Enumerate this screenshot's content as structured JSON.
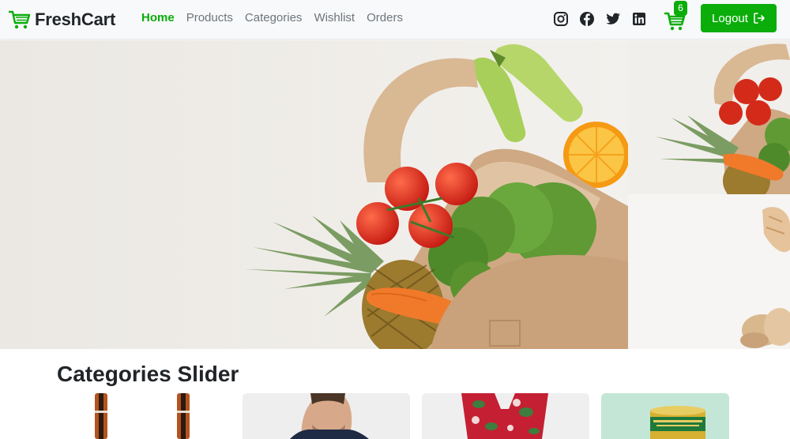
{
  "brand": {
    "name": "FreshCart",
    "icon": "cart-icon",
    "color": "#0aad0a"
  },
  "nav": {
    "links": [
      {
        "label": "Home",
        "active": true
      },
      {
        "label": "Products",
        "active": false
      },
      {
        "label": "Categories",
        "active": false
      },
      {
        "label": "Wishlist",
        "active": false
      },
      {
        "label": "Orders",
        "active": false
      }
    ]
  },
  "social": [
    "instagram-icon",
    "facebook-icon",
    "twitter-icon",
    "linkedin-icon"
  ],
  "cart": {
    "count": "6"
  },
  "logout": {
    "label": "Logout",
    "icon": "logout-icon"
  },
  "slider": {
    "active_index": 0,
    "dots": 3
  },
  "categories": {
    "title": "Categories Slider",
    "items": [
      "guitar",
      "man-portrait",
      "floral-dress",
      "canned-food"
    ]
  },
  "colors": {
    "accent": "#0aad0a",
    "dot_active": "#1976d2",
    "dot_inactive": "#b8b8b8"
  }
}
